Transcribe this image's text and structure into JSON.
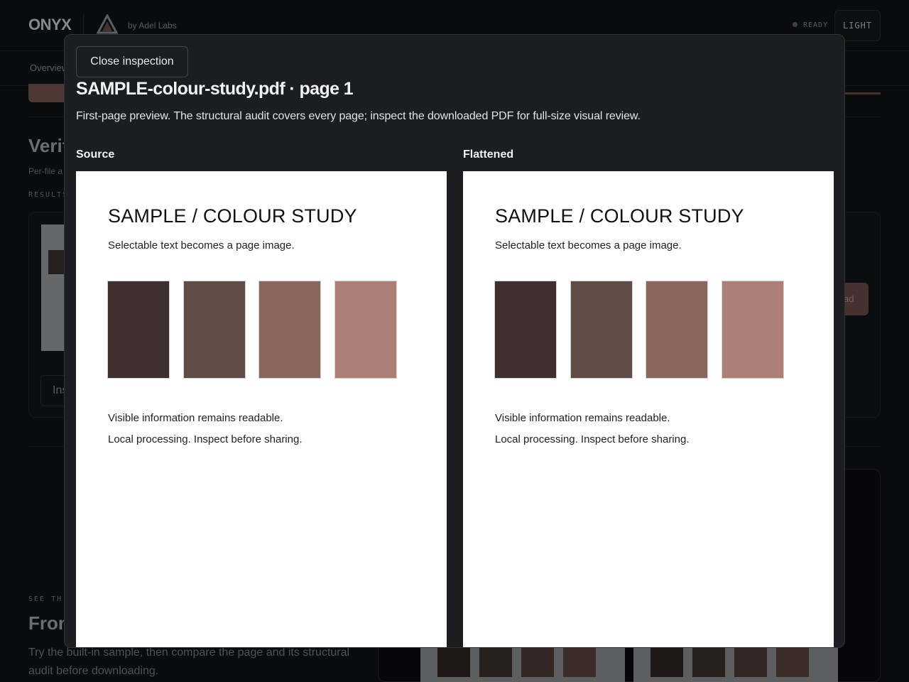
{
  "app": {
    "brand": "ONYX",
    "by_line": "by Adel Labs",
    "status": "READY",
    "theme_toggle": "LIGHT",
    "subnav_first": "Overview"
  },
  "background": {
    "verify_heading": "Verif",
    "verify_sub": "Per-file a",
    "results_label": "RESULTS",
    "inspect_button": "Ins",
    "download_button": "ad",
    "see_label": "SEE TH",
    "from_heading": "From",
    "try_text": "Try the built-in sample, then compare the page and its structural audit before downloading."
  },
  "modal": {
    "close_label": "Close inspection",
    "title": "SAMPLE-colour-study.pdf · page 1",
    "description": "First-page preview. The structural audit covers every page; inspect the downloaded PDF for full-size visual review.",
    "source_label": "Source",
    "flattened_label": "Flattened"
  },
  "sheet": {
    "title": "SAMPLE / COLOUR STUDY",
    "subtitle": "Selectable text becomes a page image.",
    "line1": "Visible information remains readable.",
    "line2": "Local processing. Inspect before sharing.",
    "swatch_colors": [
      "#3f302f",
      "#5f4c45",
      "#8a665d",
      "#ad8077"
    ]
  },
  "colors": {
    "accent": "#9a6a65",
    "modal_bg": "#1b1d20",
    "page_bg": "#0f1113"
  }
}
